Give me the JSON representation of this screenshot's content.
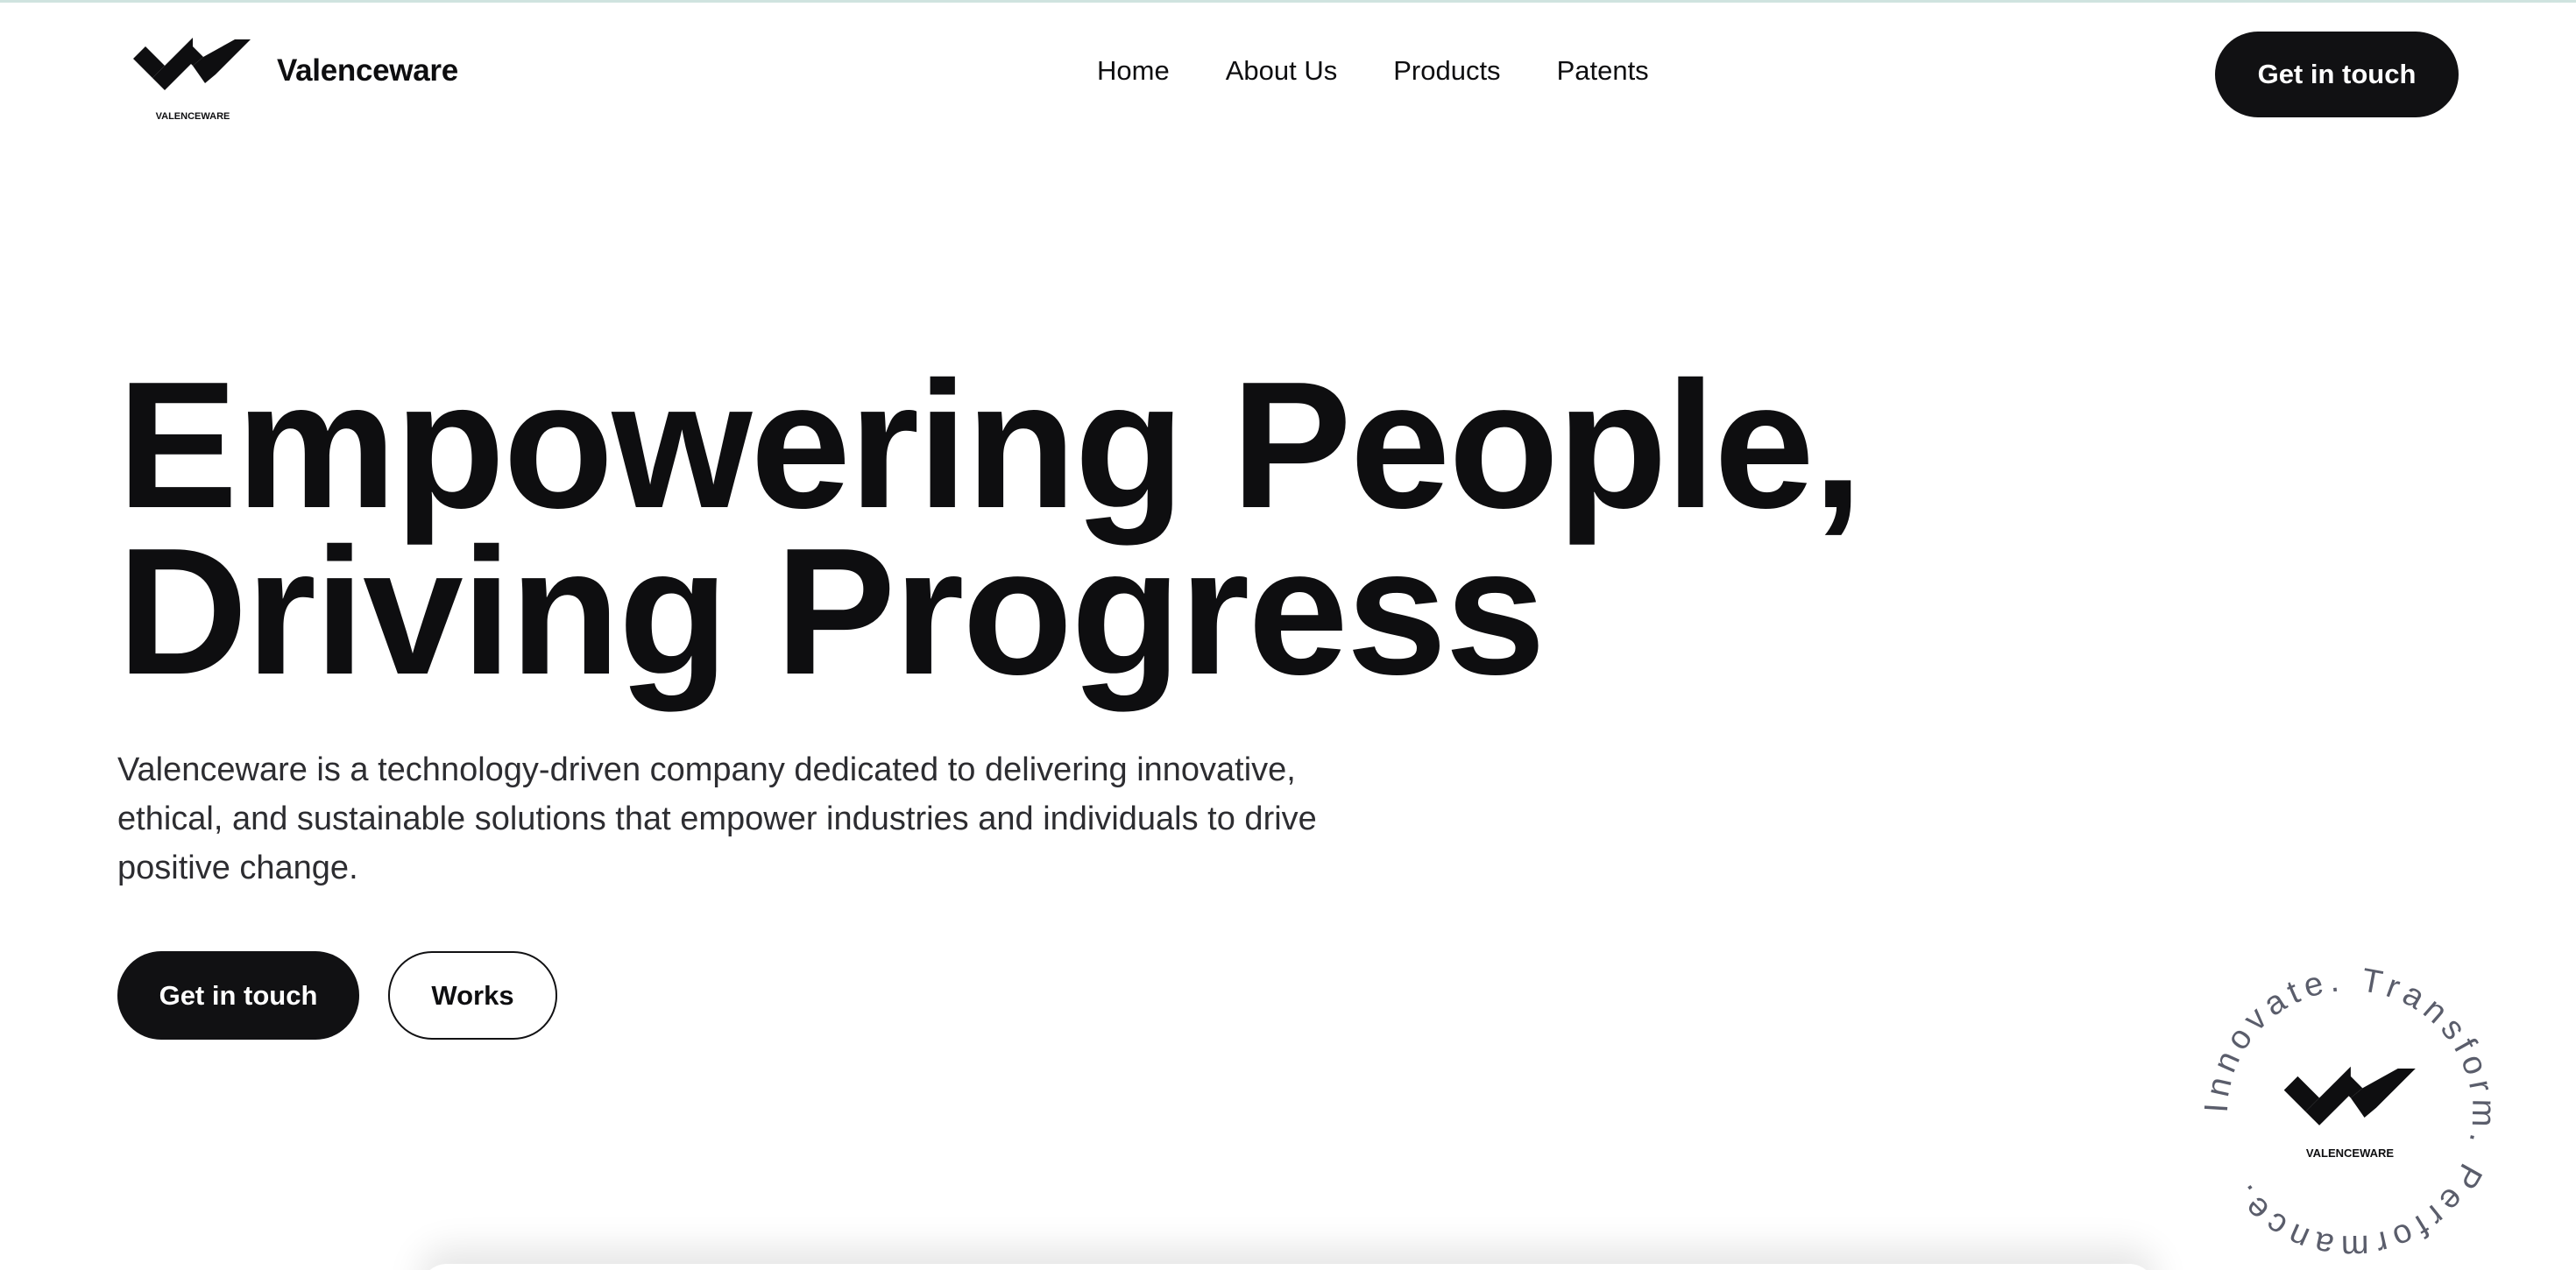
{
  "header": {
    "brand_name": "Valenceware",
    "logo_text": "VALENCEWARE",
    "nav": [
      {
        "label": "Home"
      },
      {
        "label": "About Us"
      },
      {
        "label": "Products"
      },
      {
        "label": "Patents"
      }
    ],
    "cta_label": "Get in touch"
  },
  "hero": {
    "title_line1": "Empowering People,",
    "title_line2": "Driving Progress",
    "description": "Valenceware is a technology-driven company dedicated to delivering innovative, ethical, and sustainable solutions that empower industries and individuals to drive positive change.",
    "primary_button": "Get in touch",
    "secondary_button": "Works"
  },
  "badge": {
    "circular_text": "Innovate. Transform. Performance. ",
    "logo_text": "VALENCEWARE"
  },
  "colors": {
    "text": "#0e0e10",
    "button_dark": "#111113",
    "badge_text": "#5a5d6b",
    "top_border": "#cfe3df"
  },
  "icons": {
    "brand_logo": "valenceware-double-check-icon",
    "badge_logo": "valenceware-double-check-icon"
  }
}
